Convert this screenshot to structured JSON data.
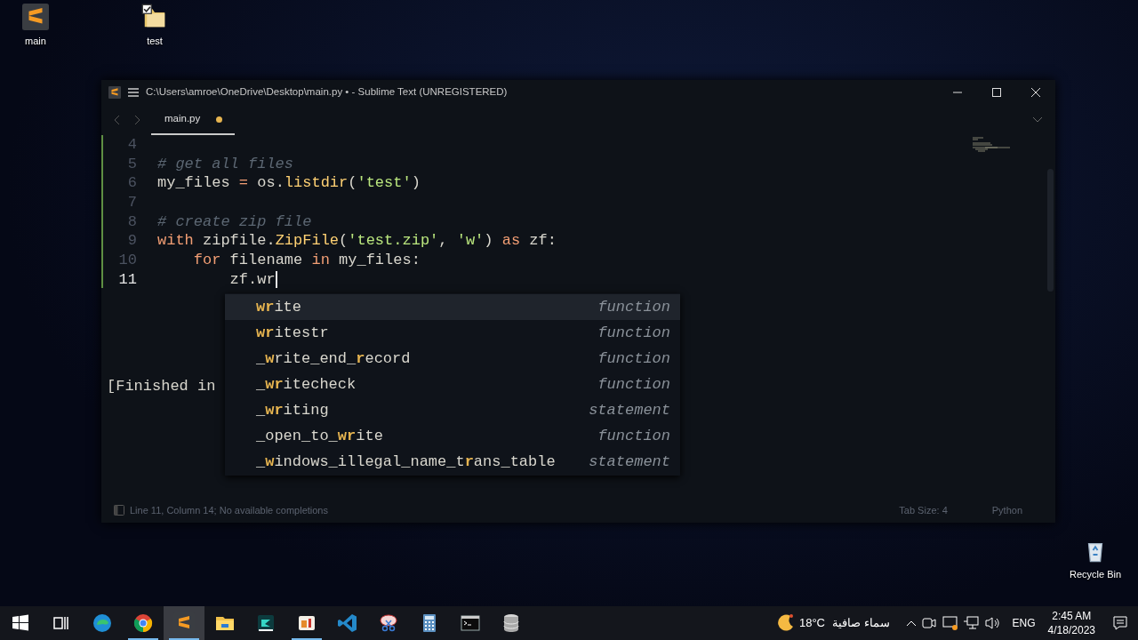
{
  "desktop_icons": [
    {
      "label": "main",
      "kind": "sublime"
    },
    {
      "label": "test",
      "kind": "folder"
    },
    {
      "label": "Recycle Bin",
      "kind": "recycle"
    }
  ],
  "window": {
    "title": "C:\\Users\\amroe\\OneDrive\\Desktop\\main.py • - Sublime Text (UNREGISTERED)"
  },
  "tabs": [
    {
      "label": "main.py",
      "selected": true,
      "dirty": true
    }
  ],
  "editor": {
    "lines": [
      {
        "number": "4",
        "current": false
      },
      {
        "number": "5",
        "current": false,
        "tokens": [
          {
            "kind": "comment",
            "text": "# get all files"
          }
        ]
      },
      {
        "number": "6",
        "current": false,
        "tokens": [
          {
            "kind": "plain",
            "text": "my_files "
          },
          {
            "kind": "keyword",
            "text": "="
          },
          {
            "kind": "plain",
            "text": " os."
          },
          {
            "kind": "function",
            "text": "listdir"
          },
          {
            "kind": "plain",
            "text": "("
          },
          {
            "kind": "string",
            "text": "'test'"
          },
          {
            "kind": "plain",
            "text": ")"
          }
        ]
      },
      {
        "number": "7",
        "current": false
      },
      {
        "number": "8",
        "current": false,
        "tokens": [
          {
            "kind": "comment",
            "text": "# create zip file"
          }
        ]
      },
      {
        "number": "9",
        "current": false,
        "tokens": [
          {
            "kind": "keyword",
            "text": "with"
          },
          {
            "kind": "plain",
            "text": " zipfile."
          },
          {
            "kind": "function",
            "text": "ZipFile"
          },
          {
            "kind": "plain",
            "text": "("
          },
          {
            "kind": "string",
            "text": "'test.zip'"
          },
          {
            "kind": "plain",
            "text": ", "
          },
          {
            "kind": "string",
            "text": "'w'"
          },
          {
            "kind": "plain",
            "text": ") "
          },
          {
            "kind": "keyword",
            "text": "as"
          },
          {
            "kind": "plain",
            "text": " zf:"
          }
        ]
      },
      {
        "number": "10",
        "current": false,
        "tokens": [
          {
            "kind": "keyword",
            "text": "    for"
          },
          {
            "kind": "plain",
            "text": " filename "
          },
          {
            "kind": "keyword",
            "text": "in"
          },
          {
            "kind": "plain",
            "text": " my_files:"
          }
        ]
      },
      {
        "number": "11",
        "current": true,
        "tokens": [
          {
            "kind": "plain",
            "text": "        zf.wr"
          }
        ]
      }
    ],
    "completions": [
      {
        "name": "**wr**ite",
        "type": "function",
        "selected": true
      },
      {
        "name": "**wr**itestr",
        "type": "function",
        "selected": false
      },
      {
        "name": "_**w**rite_end_**r**ecord",
        "type": "function",
        "selected": false
      },
      {
        "name": "_**wr**itecheck",
        "type": "function",
        "selected": false
      },
      {
        "name": "_**wr**iting",
        "type": "statement",
        "selected": false
      },
      {
        "name": "_open_to_**wr**ite",
        "type": "function",
        "selected": false
      },
      {
        "name": "_**w**indows_illegal_name_t**r**ans_table",
        "type": "statement",
        "selected": false
      }
    ]
  },
  "output_panel": {
    "text": "[Finished in"
  },
  "status_bar": {
    "position": "Line 11, Column 14; No available completions",
    "tab_size": "Tab Size: 4",
    "syntax": "Python"
  },
  "taskbar": {
    "apps": [
      {
        "kind": "windows",
        "running": false,
        "selected": false
      },
      {
        "kind": "taskview",
        "running": false,
        "selected": false
      },
      {
        "kind": "edge",
        "running": false,
        "selected": false
      },
      {
        "kind": "chrome",
        "running": true,
        "selected": false
      },
      {
        "kind": "sublime",
        "running": true,
        "selected": true
      },
      {
        "kind": "explorer",
        "running": false,
        "selected": false
      },
      {
        "kind": "editor",
        "running": false,
        "selected": false
      },
      {
        "kind": "photos",
        "running": true,
        "selected": false
      },
      {
        "kind": "vscode",
        "running": false,
        "selected": false
      },
      {
        "kind": "snipping",
        "running": false,
        "selected": false
      },
      {
        "kind": "calculator",
        "running": false,
        "selected": false
      },
      {
        "kind": "terminal",
        "running": false,
        "selected": false
      },
      {
        "kind": "database",
        "running": false,
        "selected": false
      }
    ],
    "weather": {
      "temperature": "18°C",
      "condition": "سماء صافية"
    },
    "language": "ENG",
    "time": "2:45 AM",
    "date": "4/18/2023"
  }
}
